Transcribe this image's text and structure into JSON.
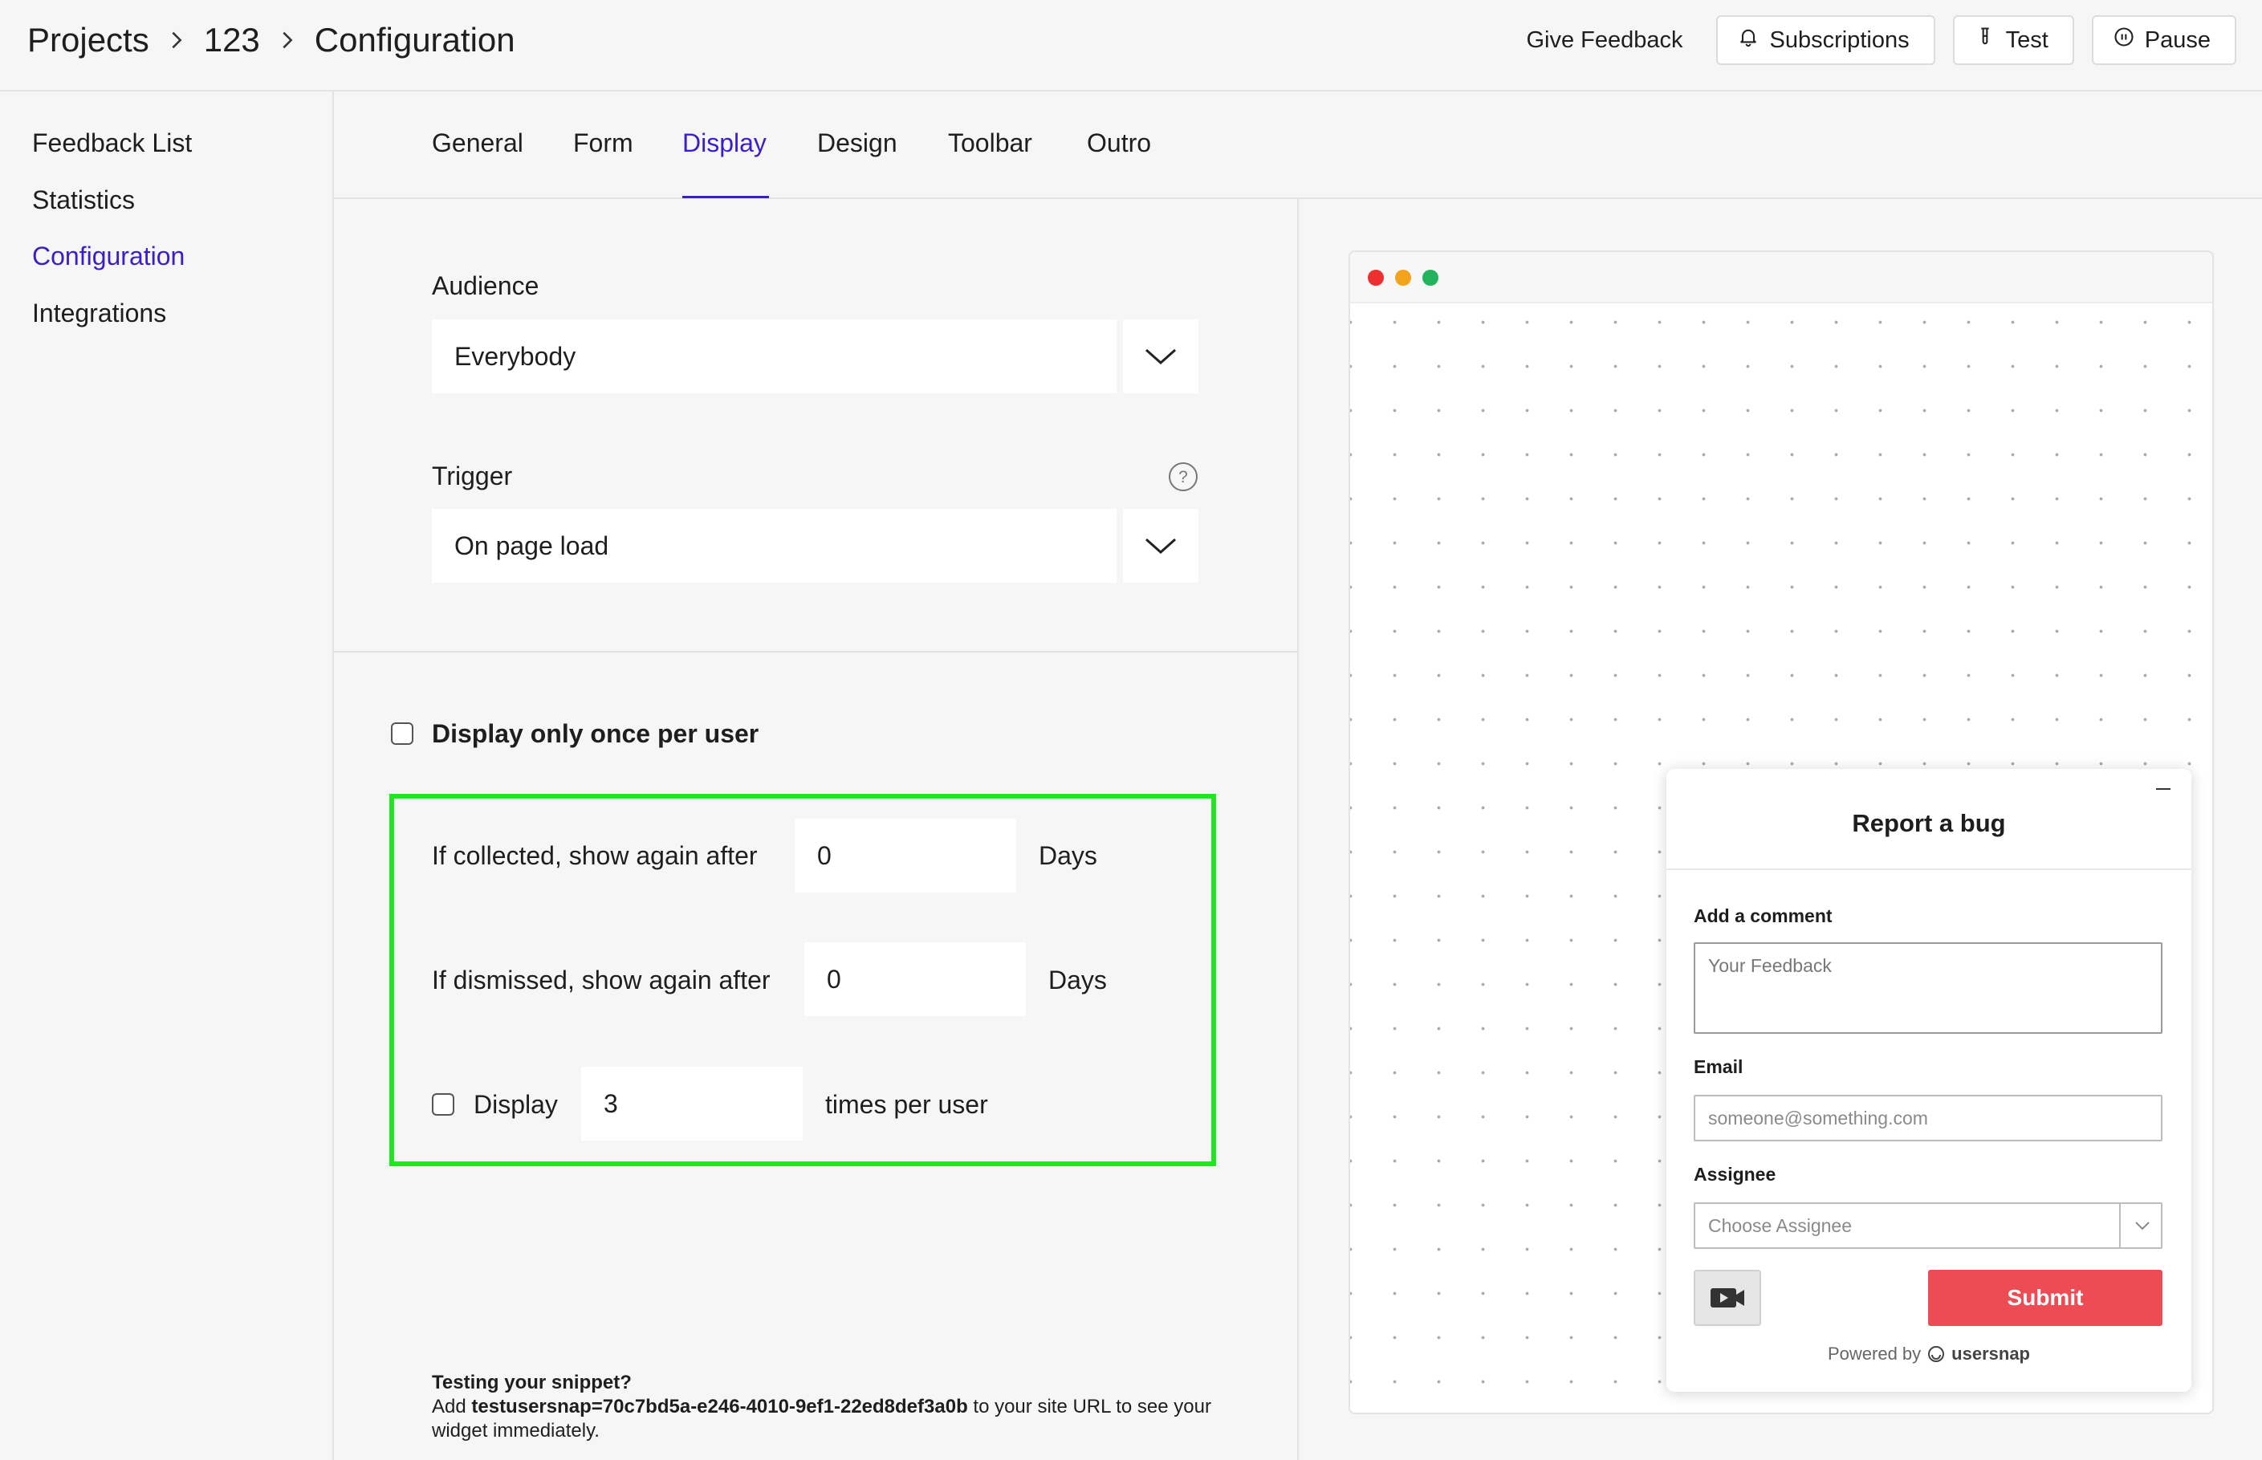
{
  "header": {
    "breadcrumbs": [
      "Projects",
      "123",
      "Configuration"
    ],
    "give_feedback": "Give Feedback",
    "buttons": {
      "subscriptions": "Subscriptions",
      "test": "Test",
      "pause": "Pause"
    }
  },
  "sidebar": {
    "items": [
      {
        "label": "Feedback List",
        "active": false
      },
      {
        "label": "Statistics",
        "active": false
      },
      {
        "label": "Configuration",
        "active": true
      },
      {
        "label": "Integrations",
        "active": false
      }
    ]
  },
  "tabs": [
    {
      "label": "General",
      "active": false
    },
    {
      "label": "Form",
      "active": false
    },
    {
      "label": "Display",
      "active": true
    },
    {
      "label": "Design",
      "active": false
    },
    {
      "label": "Toolbar",
      "active": false
    },
    {
      "label": "Outro",
      "active": false
    }
  ],
  "form": {
    "audience": {
      "label": "Audience",
      "value": "Everybody"
    },
    "trigger": {
      "label": "Trigger",
      "value": "On page load"
    },
    "display_once": {
      "label": "Display only once per user",
      "checked": false
    },
    "collected": {
      "label": "If collected, show again after",
      "value": "0",
      "unit": "Days"
    },
    "dismissed": {
      "label": "If dismissed, show again after",
      "value": "0",
      "unit": "Days"
    },
    "display_times": {
      "label": "Display",
      "value": "3",
      "suffix": "times per user",
      "checked": false
    }
  },
  "snippet": {
    "title": "Testing your snippet?",
    "prefix": "Add ",
    "code": "testusersnap=70c7bd5a-e246-4010-9ef1-22ed8def3a0b",
    "suffix": " to your site URL to see your widget immediately."
  },
  "preview": {
    "dot_colors": [
      "#ee2f2f",
      "#f2a31b",
      "#23b35c"
    ],
    "widget": {
      "title": "Report a bug",
      "comment_label": "Add a comment",
      "comment_placeholder": "Your Feedback",
      "email_label": "Email",
      "email_placeholder": "someone@something.com",
      "assignee_label": "Assignee",
      "assignee_placeholder": "Choose Assignee",
      "submit": "Submit",
      "powered_by": "Powered by",
      "brand": "usersnap",
      "submit_color": "#ee4c55"
    }
  },
  "colors": {
    "accent": "#3b1ec9",
    "highlight_border": "#22e622"
  }
}
